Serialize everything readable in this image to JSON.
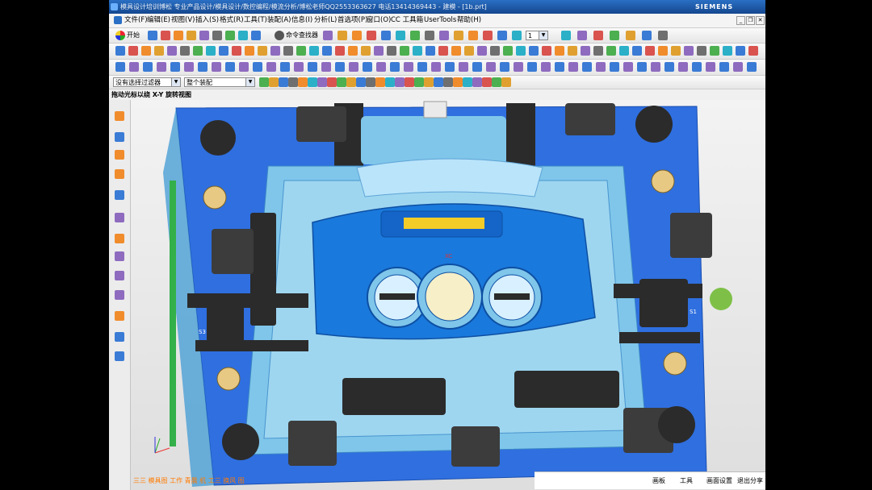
{
  "window": {
    "title": "模具设计培训博松 专业产品设计/模具设计/数控编程/模流分析/博松老师QQ2553363627 电话13414369443 - 建模 - [1b.prt]",
    "brand": "SIEMENS",
    "controls": [
      "_",
      "❐",
      "✕"
    ]
  },
  "menu": {
    "items": [
      "文件(F)",
      "编辑(E)",
      "视图(V)",
      "插入(S)",
      "格式(R)",
      "工具(T)",
      "装配(A)",
      "信息(I)",
      "分析(L)",
      "首选项(P)",
      "窗口(O)",
      "CC 工具箱",
      "UserTools",
      "帮助(H)"
    ]
  },
  "toolbar": {
    "start_label": "开始",
    "command_finder_label": "命令查找器",
    "layer_value": "1"
  },
  "selection": {
    "filter_value": "没有选择过滤器",
    "assembly_value": "整个装配"
  },
  "hint": "拖动光标以绕 X-Y 旋转视图",
  "viewport": {
    "triad_label": "XC",
    "side_label_left": "S3",
    "side_label_right": "S1",
    "colors": {
      "mold_base": "#2f6fe0",
      "inner_plate": "#7fc6ea",
      "core": "#1a79dc",
      "dark_parts": "#2b2b2b",
      "brass": "#e8c983"
    }
  },
  "bottom_bar": {
    "items": [
      "画板",
      "工具",
      "画面设置",
      "退出分享"
    ]
  },
  "overlay_text": "三三 模具图 工作 青晨 机 工三 换风 图"
}
